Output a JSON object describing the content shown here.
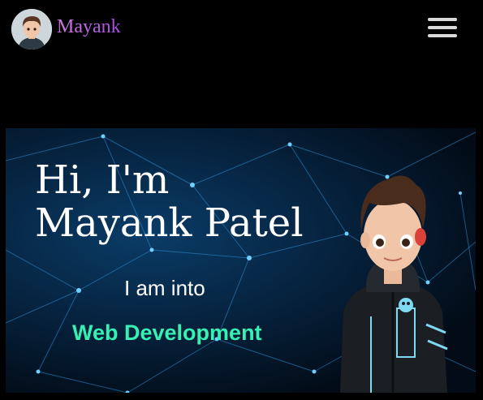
{
  "header": {
    "brand": "Mayank",
    "avatar_icon": "avatar-icon",
    "menu_icon": "hamburger-menu-icon"
  },
  "hero": {
    "greeting_line1": "Hi, I'm",
    "greeting_line2": "Mayank Patel",
    "into_text": "I am into",
    "skill": "Web Development",
    "illustration": "cartoon-developer-character"
  },
  "colors": {
    "brand": "#b85de4",
    "skill": "#37f0b4",
    "background": "#000000"
  }
}
